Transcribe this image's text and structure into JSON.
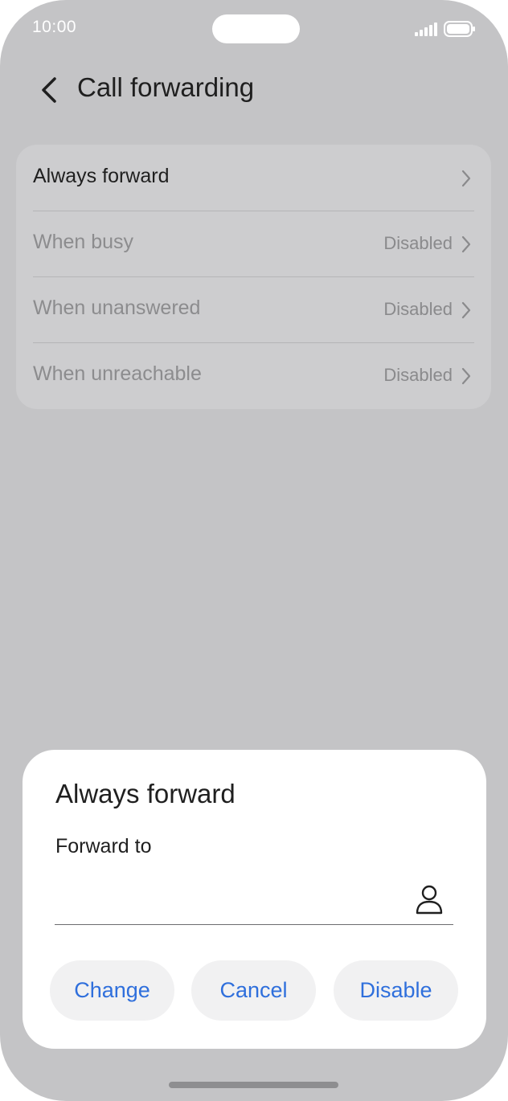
{
  "status_bar": {
    "time": "10:00"
  },
  "header": {
    "title": "Call forwarding"
  },
  "settings": {
    "items": [
      {
        "label": "Always forward",
        "value": ""
      },
      {
        "label": "When busy",
        "value": "Disabled"
      },
      {
        "label": "When unanswered",
        "value": "Disabled"
      },
      {
        "label": "When unreachable",
        "value": "Disabled"
      }
    ]
  },
  "dialog": {
    "title": "Always forward",
    "field_label": "Forward to",
    "field_value": "",
    "buttons": {
      "change": "Change",
      "cancel": "Cancel",
      "disable": "Disable"
    }
  },
  "colors": {
    "background": "#c4c4c6",
    "card": "#cdcdcf",
    "accent": "#2f6fdc",
    "dimmed_text": "#8c8c8e"
  }
}
